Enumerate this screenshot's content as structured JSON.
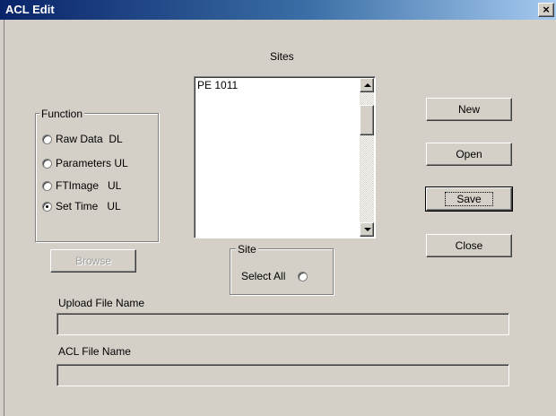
{
  "window": {
    "title": "ACL Edit",
    "close_glyph": "×"
  },
  "sites": {
    "label": "Sites",
    "items": [
      "PE 1011"
    ]
  },
  "function_group": {
    "title": "Function",
    "options": [
      {
        "label": "Raw Data  DL",
        "checked": false
      },
      {
        "label": "Parameters UL",
        "checked": false
      },
      {
        "label": "FTImage   UL",
        "checked": false
      },
      {
        "label": "Set Time   UL",
        "checked": true
      }
    ]
  },
  "buttons": {
    "new": "New",
    "open": "Open",
    "save": "Save",
    "close": "Close",
    "browse": "Browse"
  },
  "site_group": {
    "title": "Site",
    "select_all_label": "Select All",
    "select_all_checked": false
  },
  "upload": {
    "label": "Upload File Name",
    "value": ""
  },
  "acl": {
    "label": "ACL File Name",
    "value": ""
  },
  "icons": {
    "close": "close-icon",
    "scroll_up": "arrow-up-icon",
    "scroll_down": "arrow-down-icon"
  }
}
